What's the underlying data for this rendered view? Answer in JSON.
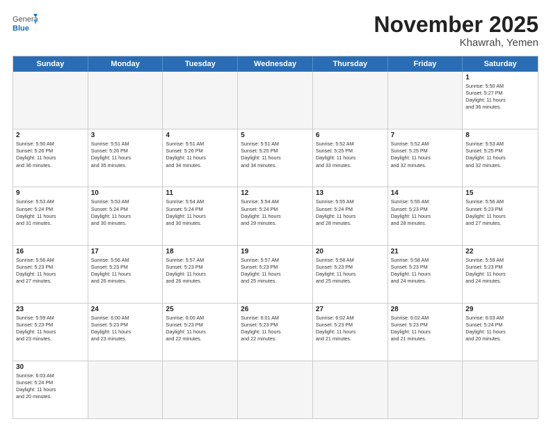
{
  "logo": {
    "general": "General",
    "blue": "Blue"
  },
  "title": "November 2025",
  "location": "Khawrah, Yemen",
  "header_days": [
    "Sunday",
    "Monday",
    "Tuesday",
    "Wednesday",
    "Thursday",
    "Friday",
    "Saturday"
  ],
  "rows": [
    [
      {
        "day": "",
        "empty": true,
        "info": ""
      },
      {
        "day": "",
        "empty": true,
        "info": ""
      },
      {
        "day": "",
        "empty": true,
        "info": ""
      },
      {
        "day": "",
        "empty": true,
        "info": ""
      },
      {
        "day": "",
        "empty": true,
        "info": ""
      },
      {
        "day": "",
        "empty": true,
        "info": ""
      },
      {
        "day": "1",
        "info": "Sunrise: 5:50 AM\nSunset: 5:27 PM\nDaylight: 11 hours\nand 36 minutes."
      }
    ],
    [
      {
        "day": "2",
        "info": "Sunrise: 5:50 AM\nSunset: 5:26 PM\nDaylight: 11 hours\nand 36 minutes."
      },
      {
        "day": "3",
        "info": "Sunrise: 5:51 AM\nSunset: 5:26 PM\nDaylight: 11 hours\nand 35 minutes."
      },
      {
        "day": "4",
        "info": "Sunrise: 5:51 AM\nSunset: 5:26 PM\nDaylight: 11 hours\nand 34 minutes."
      },
      {
        "day": "5",
        "info": "Sunrise: 5:51 AM\nSunset: 5:25 PM\nDaylight: 11 hours\nand 34 minutes."
      },
      {
        "day": "6",
        "info": "Sunrise: 5:52 AM\nSunset: 5:25 PM\nDaylight: 11 hours\nand 33 minutes."
      },
      {
        "day": "7",
        "info": "Sunrise: 5:52 AM\nSunset: 5:25 PM\nDaylight: 11 hours\nand 32 minutes."
      },
      {
        "day": "8",
        "info": "Sunrise: 5:53 AM\nSunset: 5:25 PM\nDaylight: 11 hours\nand 32 minutes."
      }
    ],
    [
      {
        "day": "9",
        "info": "Sunrise: 5:53 AM\nSunset: 5:24 PM\nDaylight: 11 hours\nand 31 minutes."
      },
      {
        "day": "10",
        "info": "Sunrise: 5:53 AM\nSunset: 5:24 PM\nDaylight: 11 hours\nand 30 minutes."
      },
      {
        "day": "11",
        "info": "Sunrise: 5:54 AM\nSunset: 5:24 PM\nDaylight: 11 hours\nand 30 minutes."
      },
      {
        "day": "12",
        "info": "Sunrise: 5:54 AM\nSunset: 5:24 PM\nDaylight: 11 hours\nand 29 minutes."
      },
      {
        "day": "13",
        "info": "Sunrise: 5:55 AM\nSunset: 5:24 PM\nDaylight: 11 hours\nand 28 minutes."
      },
      {
        "day": "14",
        "info": "Sunrise: 5:55 AM\nSunset: 5:23 PM\nDaylight: 11 hours\nand 28 minutes."
      },
      {
        "day": "15",
        "info": "Sunrise: 5:56 AM\nSunset: 5:23 PM\nDaylight: 11 hours\nand 27 minutes."
      }
    ],
    [
      {
        "day": "16",
        "info": "Sunrise: 5:56 AM\nSunset: 5:23 PM\nDaylight: 11 hours\nand 27 minutes."
      },
      {
        "day": "17",
        "info": "Sunrise: 5:56 AM\nSunset: 5:23 PM\nDaylight: 11 hours\nand 26 minutes."
      },
      {
        "day": "18",
        "info": "Sunrise: 5:57 AM\nSunset: 5:23 PM\nDaylight: 11 hours\nand 26 minutes."
      },
      {
        "day": "19",
        "info": "Sunrise: 5:57 AM\nSunset: 5:23 PM\nDaylight: 11 hours\nand 25 minutes."
      },
      {
        "day": "20",
        "info": "Sunrise: 5:58 AM\nSunset: 5:23 PM\nDaylight: 11 hours\nand 25 minutes."
      },
      {
        "day": "21",
        "info": "Sunrise: 5:58 AM\nSunset: 5:23 PM\nDaylight: 11 hours\nand 24 minutes."
      },
      {
        "day": "22",
        "info": "Sunrise: 5:59 AM\nSunset: 5:23 PM\nDaylight: 11 hours\nand 24 minutes."
      }
    ],
    [
      {
        "day": "23",
        "info": "Sunrise: 5:59 AM\nSunset: 5:23 PM\nDaylight: 11 hours\nand 23 minutes."
      },
      {
        "day": "24",
        "info": "Sunrise: 6:00 AM\nSunset: 5:23 PM\nDaylight: 11 hours\nand 23 minutes."
      },
      {
        "day": "25",
        "info": "Sunrise: 6:00 AM\nSunset: 5:23 PM\nDaylight: 11 hours\nand 22 minutes."
      },
      {
        "day": "26",
        "info": "Sunrise: 6:01 AM\nSunset: 5:23 PM\nDaylight: 11 hours\nand 22 minutes."
      },
      {
        "day": "27",
        "info": "Sunrise: 6:02 AM\nSunset: 5:23 PM\nDaylight: 11 hours\nand 21 minutes."
      },
      {
        "day": "28",
        "info": "Sunrise: 6:02 AM\nSunset: 5:23 PM\nDaylight: 11 hours\nand 21 minutes."
      },
      {
        "day": "29",
        "info": "Sunrise: 6:03 AM\nSunset: 5:24 PM\nDaylight: 11 hours\nand 20 minutes."
      }
    ],
    [
      {
        "day": "30",
        "info": "Sunrise: 6:03 AM\nSunset: 5:24 PM\nDaylight: 11 hours\nand 20 minutes."
      },
      {
        "day": "",
        "empty": true,
        "info": ""
      },
      {
        "day": "",
        "empty": true,
        "info": ""
      },
      {
        "day": "",
        "empty": true,
        "info": ""
      },
      {
        "day": "",
        "empty": true,
        "info": ""
      },
      {
        "day": "",
        "empty": true,
        "info": ""
      },
      {
        "day": "",
        "empty": true,
        "info": ""
      }
    ]
  ]
}
